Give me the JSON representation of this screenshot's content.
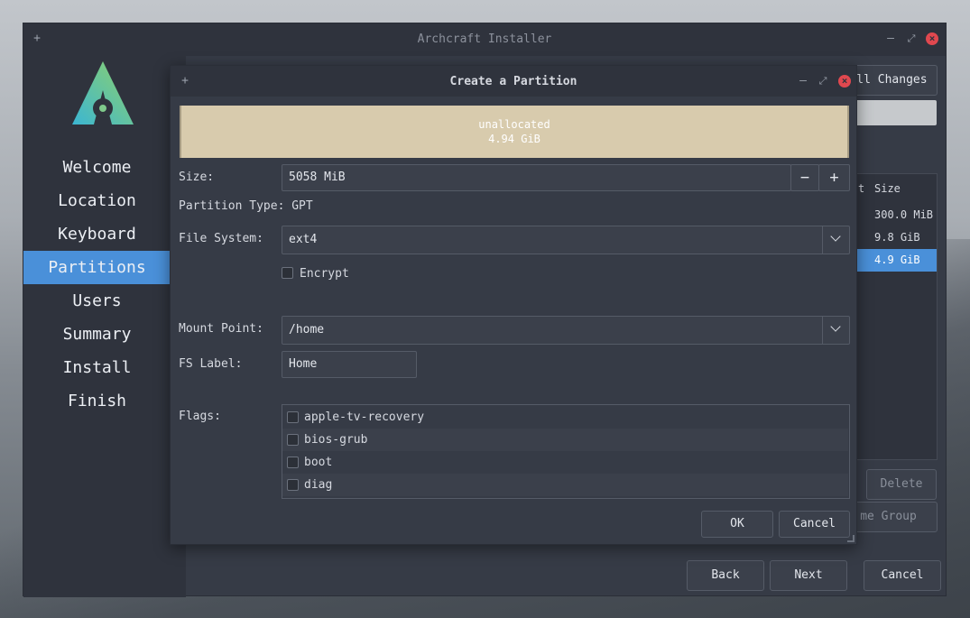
{
  "window": {
    "title": "Archcraft Installer"
  },
  "sidebar": {
    "items": [
      {
        "label": "Welcome"
      },
      {
        "label": "Location"
      },
      {
        "label": "Keyboard"
      },
      {
        "label": "Partitions"
      },
      {
        "label": "Users"
      },
      {
        "label": "Summary"
      },
      {
        "label": "Install"
      },
      {
        "label": "Finish"
      }
    ],
    "active": "Partitions"
  },
  "background": {
    "revert_label": "All Changes",
    "table_header": {
      "col1": "t",
      "col2": "Size"
    },
    "sizes": [
      "300.0 MiB",
      "9.8 GiB",
      "4.9 GiB"
    ],
    "delete_label": "Delete",
    "volume_group_label": "me Group"
  },
  "footer": {
    "back": "Back",
    "next": "Next",
    "cancel": "Cancel"
  },
  "dialog": {
    "title": "Create a Partition",
    "segment": {
      "name": "unallocated",
      "size": "4.94 GiB",
      "color": "#d8cbad"
    },
    "size_label": "Size:",
    "size_value": "5058 MiB",
    "size_minus": "−",
    "size_plus": "+",
    "partition_type": "Partition Type: GPT",
    "fs_label": "File System:",
    "fs_value": "ext4",
    "encrypt_label": "Encrypt",
    "mount_label": "Mount Point:",
    "mount_value": "/home",
    "fslabel_label": "FS Label:",
    "fslabel_value": "Home",
    "flags_label": "Flags:",
    "flags": [
      "apple-tv-recovery",
      "bios-grub",
      "boot",
      "diag"
    ],
    "ok": "OK",
    "cancel": "Cancel"
  },
  "colors": {
    "accent": "#4a90d9",
    "close": "#e0484f",
    "window_bg": "#363b46"
  }
}
